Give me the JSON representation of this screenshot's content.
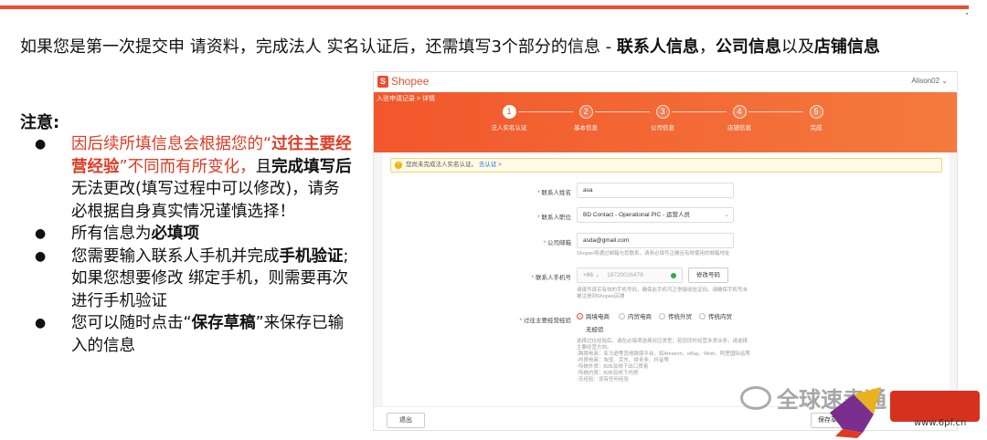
{
  "headline": {
    "part1": "如果您是第一次提交申 请资料，完成法人 实名认证后，还需填写3个部分的信息 - ",
    "contact": "联系人信息",
    "sep": "，",
    "company": "公司信息",
    "and": "以及",
    "store": "店铺信息"
  },
  "notes": {
    "title": "注意:",
    "items": [
      {
        "bullet": "●",
        "a": "因后续所填信息会根据您的“",
        "b": "过往主要经营经验",
        "c": "”不同而有所变化，",
        "d": "且",
        "e": "完成填写后",
        "f": "无法更改(填写过程中可以修改)，请务必根据自身真实情况谨慎选择！"
      },
      {
        "bullet": "●",
        "a": "所有信息为",
        "b": "必填项"
      },
      {
        "bullet": "●",
        "a": "您需要输入联系人手机并完成",
        "b": "手机验证",
        "c": ";如果您想要修改 绑定手机，则需要再次进行手机验证"
      },
      {
        "bullet": "●",
        "a": "您可以随时点击“",
        "b": "保存草稿",
        "c": "”来保存已输入的信息"
      }
    ]
  },
  "shot": {
    "logo_text": "Shopee",
    "logo_glyph": "S",
    "user": "Alison02 ⌄",
    "breadcrumb": "入驻申请记录 > 详情",
    "steps": [
      {
        "num": "1",
        "label": "法人实名认证"
      },
      {
        "num": "2",
        "label": "基本信息"
      },
      {
        "num": "3",
        "label": "公司信息"
      },
      {
        "num": "4",
        "label": "店铺信息"
      },
      {
        "num": "5",
        "label": "完成"
      }
    ],
    "warning": {
      "icon": "!",
      "text": "您尚未完成法人实名认证。",
      "link": "去认证 >"
    },
    "fields": {
      "name_label": "联系人姓名",
      "name_value": "asa",
      "position_label": "联系人职位",
      "position_value": "BD Contact - Operational PIC - 运营人员",
      "email_label": "公司邮箱",
      "email_value": "asda@gmail.com",
      "email_hint": "Shopee将通过邮箱与您联系，请务必填写正确且有效使用的邮箱地址",
      "phone_label": "联系人手机号",
      "phone_code": "+86  ⌄",
      "phone_value": "18720026478",
      "verify_btn": "修改号码",
      "phone_hint": "请填写真实有效的手机号码，确保此手机可正常接收验证码。请确保手机号未被注册到Shopee店铺",
      "experience_label": "过往主要经营经验",
      "experience_options": [
        "跨境电商",
        "内贸电商",
        "传统外贸",
        "传统内贸",
        "无经验"
      ],
      "experience_desc": [
        "选择过往经验后，请在必填项选择对应类型；若您同时经营多类业务，请选择主要经营方向。",
        "-跨境电商：亚马逊等其他跨境平台，如Amazon、eBay、Wish、阿里国际站等",
        "-内贸电商：淘宝、京东、拼多多、抖音等",
        "-传统外贸：B2B及线下出口贸易",
        "-传统内贸：B2B及线下内贸",
        "-无经验：没有任何经验"
      ]
    },
    "exit_btn": "退出",
    "save_btn": "保存草稿"
  },
  "watermark": {
    "text": "全球速卖通",
    "url": "www.6pf.cn"
  },
  "colors": {
    "accent": "#ee4d2d",
    "red_text": "#e03a22"
  }
}
